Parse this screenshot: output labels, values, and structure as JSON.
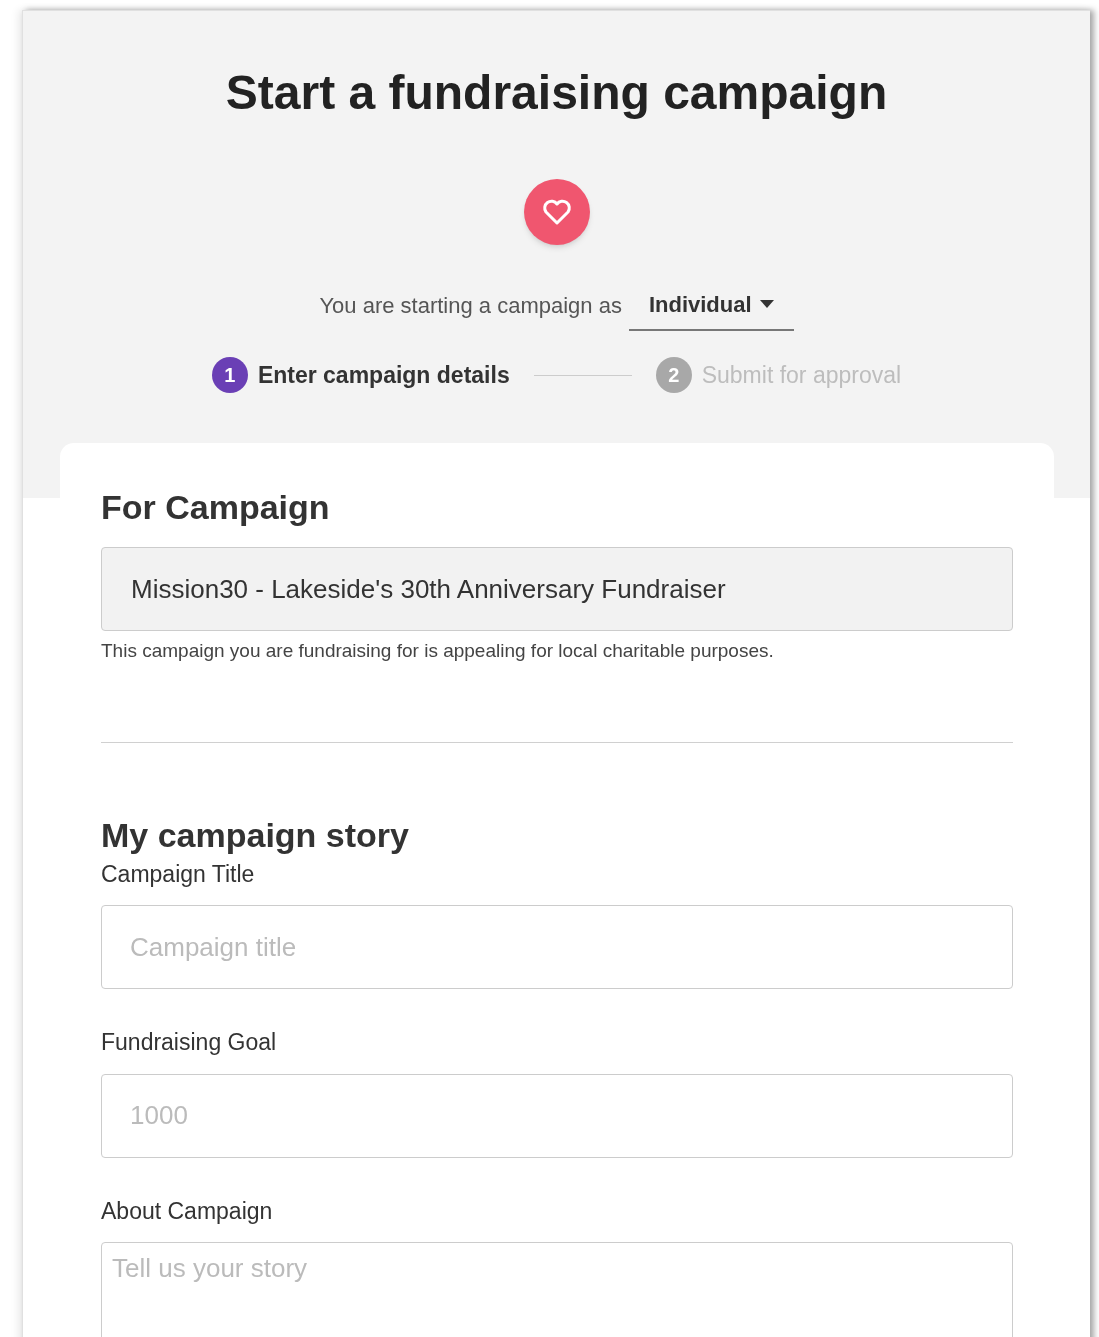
{
  "title": "Start a fundraising campaign",
  "starting_as": {
    "label": "You are starting a campaign as",
    "value": "Individual"
  },
  "steps": [
    {
      "number": "1",
      "label": "Enter campaign details",
      "selected": true
    },
    {
      "number": "2",
      "label": "Submit for approval",
      "selected": false
    }
  ],
  "for_campaign": {
    "heading": "For Campaign",
    "value": "Mission30 - Lakeside's 30th Anniversary Fundraiser",
    "note": "This campaign you are fundraising for is appealing for local charitable purposes."
  },
  "story": {
    "heading": "My campaign story",
    "fields": [
      {
        "kind": "input",
        "label": "Campaign Title",
        "placeholder": "Campaign title"
      },
      {
        "kind": "input",
        "label": "Fundraising Goal",
        "placeholder": "1000"
      },
      {
        "kind": "textarea",
        "label": "About Campaign",
        "placeholder": "Tell us your story"
      }
    ]
  }
}
